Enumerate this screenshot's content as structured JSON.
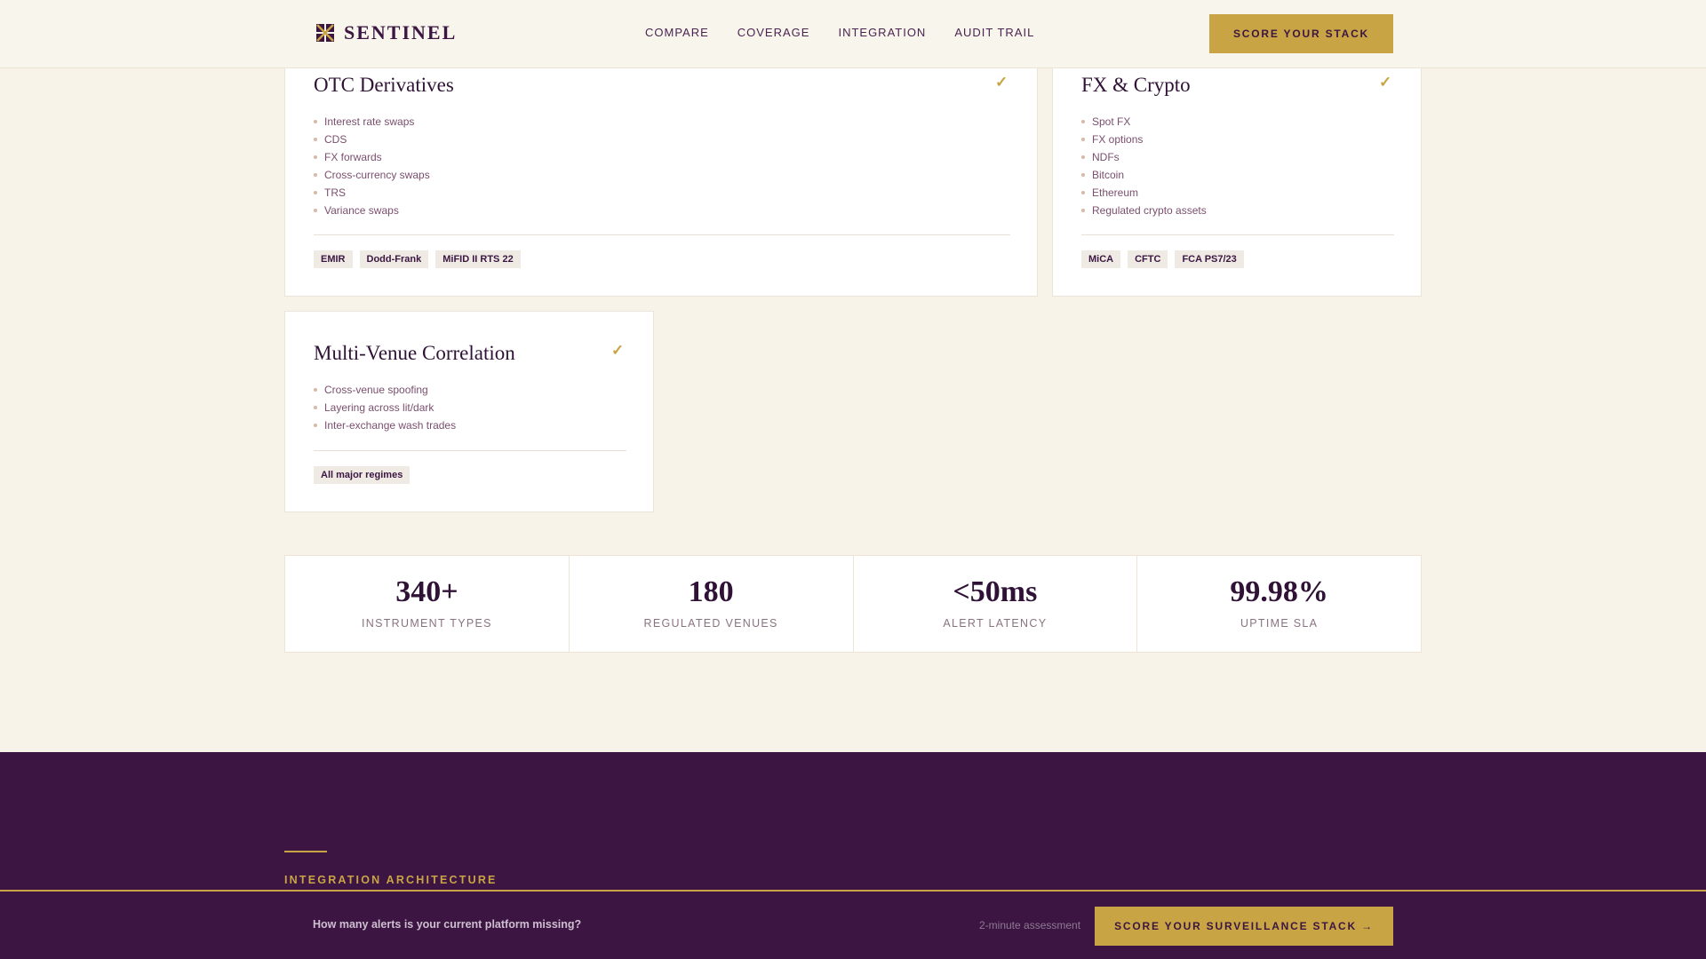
{
  "brand": {
    "name": "SENTINEL"
  },
  "nav": {
    "items": [
      "COMPARE",
      "COVERAGE",
      "INTEGRATION",
      "AUDIT TRAIL"
    ],
    "cta_label": "SCORE YOUR STACK"
  },
  "coverage_cards": [
    {
      "title": "OTC Derivatives",
      "check": "✓",
      "items": [
        "Interest rate swaps",
        "CDS",
        "FX forwards",
        "Cross-currency swaps",
        "TRS",
        "Variance swaps"
      ],
      "tags": [
        "EMIR",
        "Dodd-Frank",
        "MiFID II RTS 22"
      ]
    },
    {
      "title": "FX & Crypto",
      "check": "✓",
      "items": [
        "Spot FX",
        "FX options",
        "NDFs",
        "Bitcoin",
        "Ethereum",
        "Regulated crypto assets"
      ],
      "tags": [
        "MiCA",
        "CFTC",
        "FCA PS7/23"
      ]
    },
    {
      "title": "Multi-Venue Correlation",
      "check": "✓",
      "items": [
        "Cross-venue spoofing",
        "Layering across lit/dark",
        "Inter-exchange wash trades"
      ],
      "tags": [
        "All major regimes"
      ]
    }
  ],
  "stats": [
    {
      "value": "340+",
      "label": "INSTRUMENT TYPES"
    },
    {
      "value": "180",
      "label": "REGULATED VENUES"
    },
    {
      "value": "<50ms",
      "label": "ALERT LATENCY"
    },
    {
      "value": "99.98%",
      "label": "UPTIME SLA"
    }
  ],
  "integration": {
    "eyebrow": "INTEGRATION ARCHITECTURE"
  },
  "sticky_bar": {
    "question": "How many alerts is your current platform missing?",
    "note": "2-minute assessment",
    "cta_label": "SCORE YOUR SURVEILLANCE STACK →"
  },
  "colors": {
    "accent_gold": "#c9a445",
    "brand_purple": "#3c1542",
    "page_background": "#f7f3e9"
  },
  "icons": {
    "logo": "sentinel-logo-icon",
    "check": "check-icon",
    "bullet": "bullet-dot-icon"
  }
}
